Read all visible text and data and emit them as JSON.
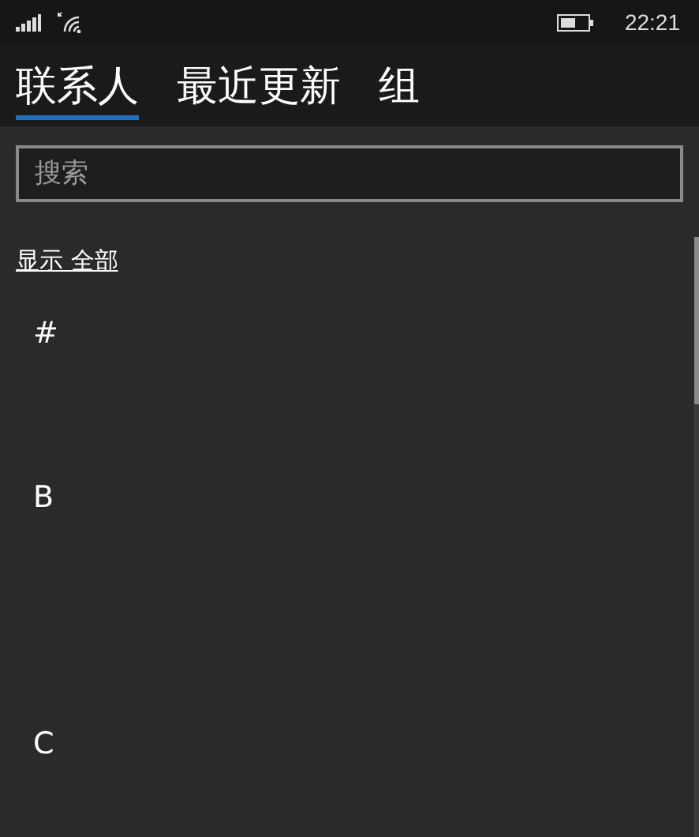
{
  "status_bar": {
    "time": "22:21"
  },
  "tabs": [
    {
      "label": "联系人",
      "selected": true
    },
    {
      "label": "最近更新",
      "selected": false
    },
    {
      "label": "组",
      "selected": false
    }
  ],
  "search": {
    "placeholder": "搜索"
  },
  "show_all_link": "显示 全部",
  "groups": [
    {
      "header": "#"
    },
    {
      "header": "B"
    },
    {
      "header": "C"
    }
  ]
}
